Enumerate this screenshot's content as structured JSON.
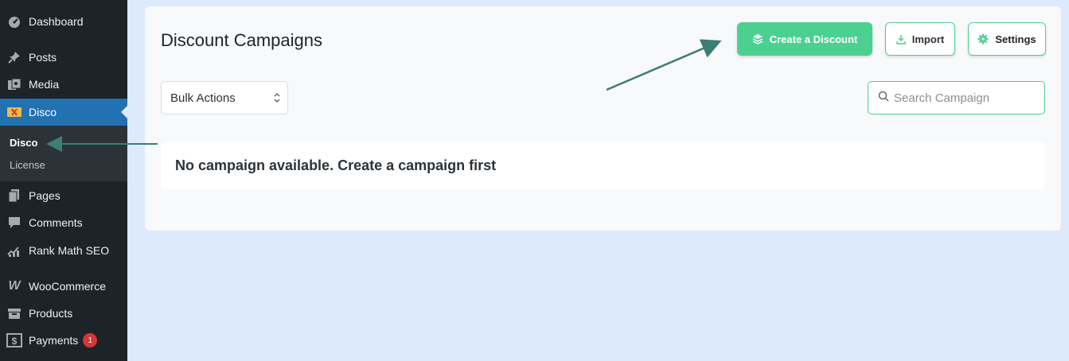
{
  "sidebar": {
    "items": [
      {
        "label": "Dashboard",
        "icon": "dashboard-icon"
      },
      {
        "label": "Posts",
        "icon": "pin-icon"
      },
      {
        "label": "Media",
        "icon": "media-icon"
      },
      {
        "label": "Disco",
        "icon": "disco-icon"
      },
      {
        "label": "Pages",
        "icon": "pages-icon"
      },
      {
        "label": "Comments",
        "icon": "comment-icon"
      },
      {
        "label": "Rank Math SEO",
        "icon": "rank-math-icon"
      },
      {
        "label": "WooCommerce",
        "icon": "woocommerce-icon"
      },
      {
        "label": "Products",
        "icon": "products-icon"
      },
      {
        "label": "Payments",
        "icon": "payments-icon",
        "badge": "1"
      }
    ],
    "submenu": [
      "Disco",
      "License"
    ]
  },
  "main": {
    "title": "Discount Campaigns",
    "buttons": {
      "create": "Create a Discount",
      "import": "Import",
      "settings": "Settings"
    },
    "bulk_actions": "Bulk Actions",
    "search_placeholder": "Search Campaign",
    "empty_message": "No campaign available. Create a campaign first"
  },
  "colors": {
    "sidebar_bg": "#1d2327",
    "active_bg": "#2271b1",
    "accent_green": "#4cd08f",
    "annotation_arrow": "#3d7d74",
    "page_bg": "#dde9fc"
  }
}
